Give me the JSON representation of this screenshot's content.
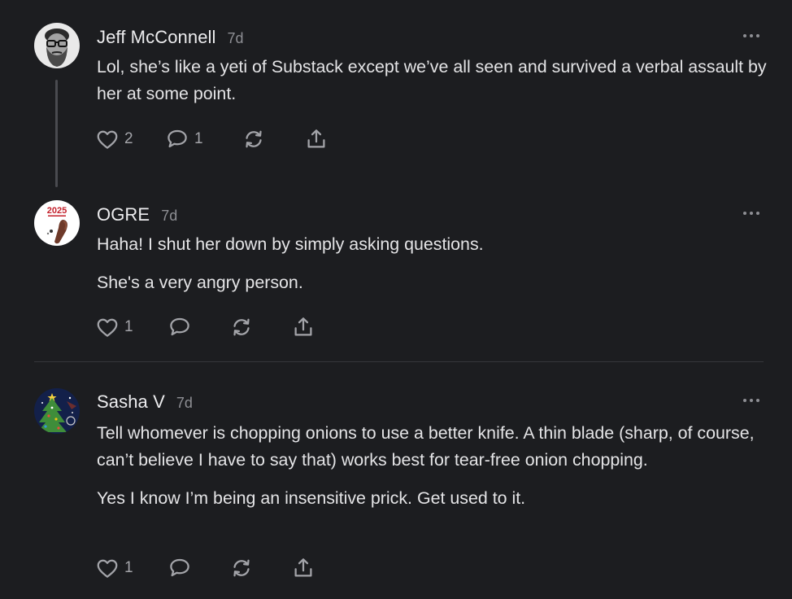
{
  "comments": [
    {
      "author": "Jeff McConnell",
      "time": "7d",
      "paragraphs": [
        "Lol, she’s like a yeti of Substack except we’ve all seen and survived a verbal assault by her at some point."
      ],
      "likes": "2",
      "replies": "1",
      "avatar_icon": "bearded-man-glasses-avatar"
    },
    {
      "author": "OGRE",
      "time": "7d",
      "paragraphs": [
        "Haha! I shut her down by simply asking questions.",
        "She's a very angry person."
      ],
      "likes": "1",
      "avatar_icon": "2025-new-year-avatar",
      "avatar_text": "2025"
    },
    {
      "author": "Sasha V",
      "time": "7d",
      "paragraphs": [
        "Tell whomever is chopping onions to use a better knife. A thin blade (sharp, of course, can’t believe I have to say that) works best for tear-free onion chopping.",
        "Yes I know I’m being an insensitive prick. Get used to it."
      ],
      "likes": "1",
      "avatar_icon": "christmas-tree-avatar"
    }
  ],
  "icons": {
    "like": "heart-icon",
    "reply": "speech-bubble-icon",
    "restack": "restack-arrows-icon",
    "share": "share-upload-icon",
    "more": "more-horizontal-icon"
  },
  "colors": {
    "background": "#1c1d20",
    "text": "#e4e4e6",
    "muted": "#8e8f94",
    "icon": "#a3a4a9",
    "divider": "#36373b",
    "thread_line": "#4a4b50"
  }
}
